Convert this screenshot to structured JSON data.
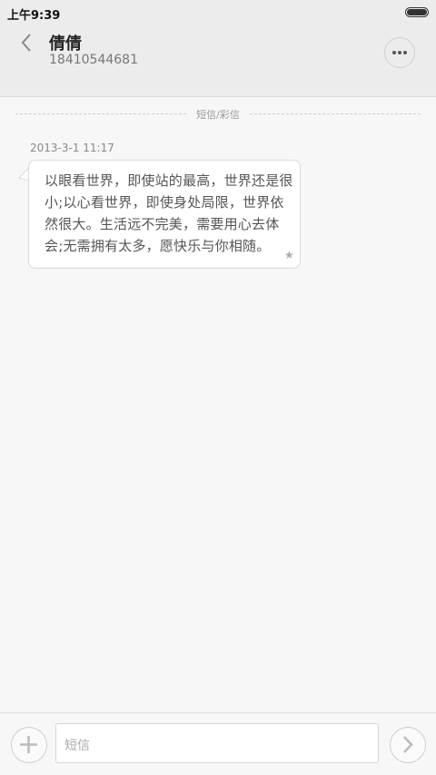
{
  "status_bar": {
    "time": "上午9:39",
    "battery_icon": "battery-icon"
  },
  "header": {
    "back_icon": "chevron-left-icon",
    "contact_name": "倩倩",
    "contact_number": "18410544681",
    "more_icon": "more-dots-icon"
  },
  "conversation": {
    "divider_label": "短信/彩信",
    "messages": [
      {
        "timestamp": "2013-3-1 11:17",
        "text": "以眼看世界，即使站的最高，世界还是很小;以心看世界，即使身处局限，世界依然很大。生活远不完美，需要用心去体会;无需拥有太多，愿快乐与你相随。",
        "star_icon": "star-icon"
      }
    ]
  },
  "composer": {
    "add_icon": "plus-icon",
    "placeholder": "短信",
    "send_icon": "chevron-right-icon"
  },
  "colors": {
    "background": "#f7f7f7",
    "header_bg": "#ececec",
    "bubble_bg": "#ffffff",
    "text": "#555555"
  }
}
